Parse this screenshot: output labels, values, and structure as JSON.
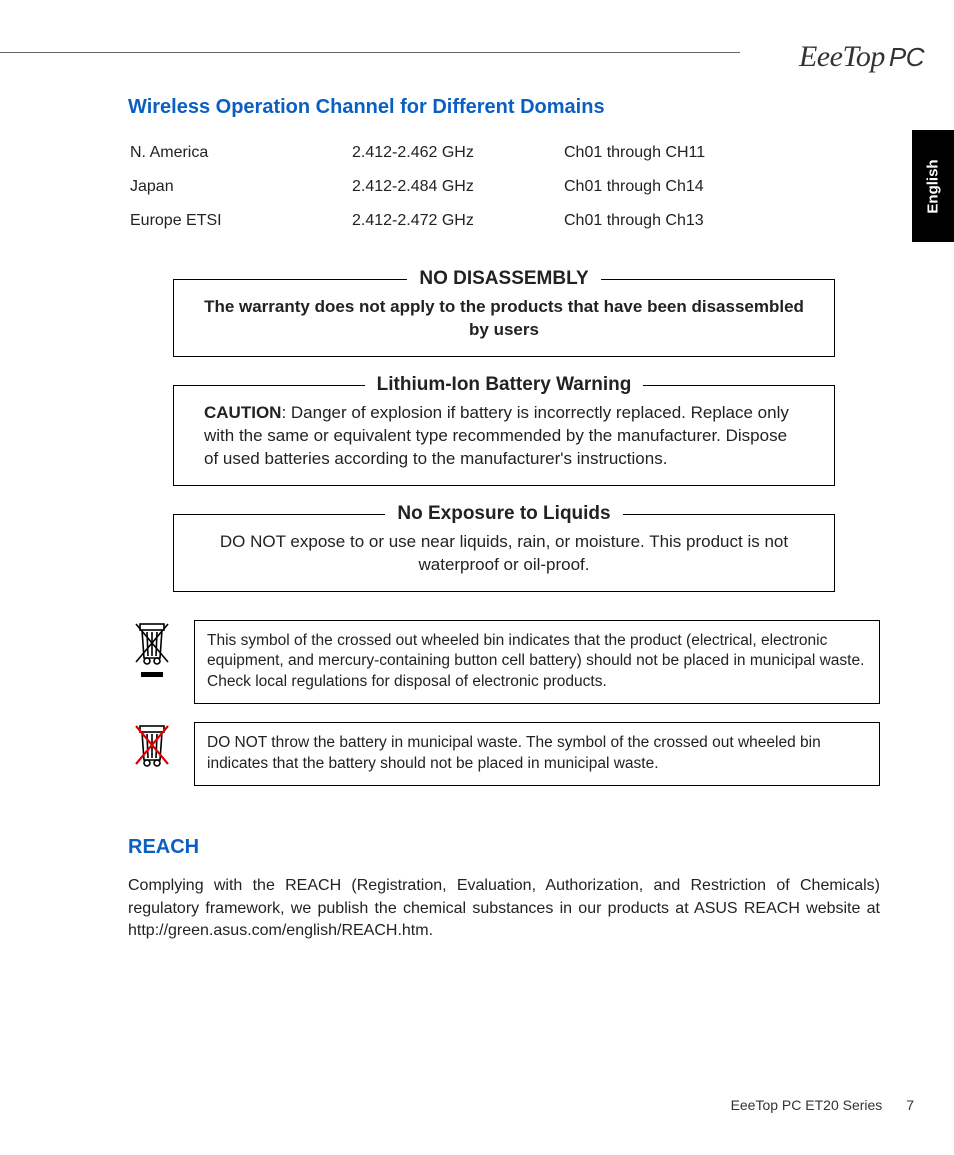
{
  "brand": {
    "name": "EeeTop",
    "suffix": "PC"
  },
  "lang_tab": "English",
  "section1": {
    "title": "Wireless Operation Channel for Different Domains",
    "rows": [
      {
        "region": "N. America",
        "freq": "2.412-2.462 GHz",
        "ch": "Ch01 through CH11"
      },
      {
        "region": "Japan",
        "freq": "2.412-2.484 GHz",
        "ch": "Ch01 through Ch14"
      },
      {
        "region": "Europe ETSI",
        "freq": "2.412-2.472 GHz",
        "ch": "Ch01 through Ch13"
      }
    ]
  },
  "box_disassembly": {
    "legend": "NO DISASSEMBLY",
    "body": "The warranty does not apply to the products that have been disassembled by users"
  },
  "box_battery": {
    "legend": "Lithium-Ion Battery Warning",
    "caution_label": "CAUTION",
    "body": ": Danger of explosion if battery is incorrectly replaced. Replace only with the same or equivalent type recommended by the manufacturer. Dispose of used batteries according to the manufacturer's instructions."
  },
  "box_liquids": {
    "legend": "No Exposure to Liquids",
    "body": "DO NOT expose to or use near liquids, rain, or moisture. This product is not waterproof or oil-proof."
  },
  "weee_text": "This symbol of the crossed out wheeled bin indicates that the product (electrical, electronic equipment, and mercury-containing button cell battery) should not be placed in municipal waste. Check local regulations for disposal of electronic products.",
  "battery_bin_text": "DO NOT throw the battery in municipal waste. The symbol of the crossed out wheeled bin indicates that the battery should not be placed in municipal waste.",
  "reach": {
    "title": "REACH",
    "body": "Complying with the REACH (Registration, Evaluation, Authorization, and Restriction of Chemicals) regulatory framework, we publish the chemical substances in our products at ASUS REACH website at http://green.asus.com/english/REACH.htm."
  },
  "footer": {
    "series": "EeeTop PC ET20 Series",
    "page": "7"
  }
}
